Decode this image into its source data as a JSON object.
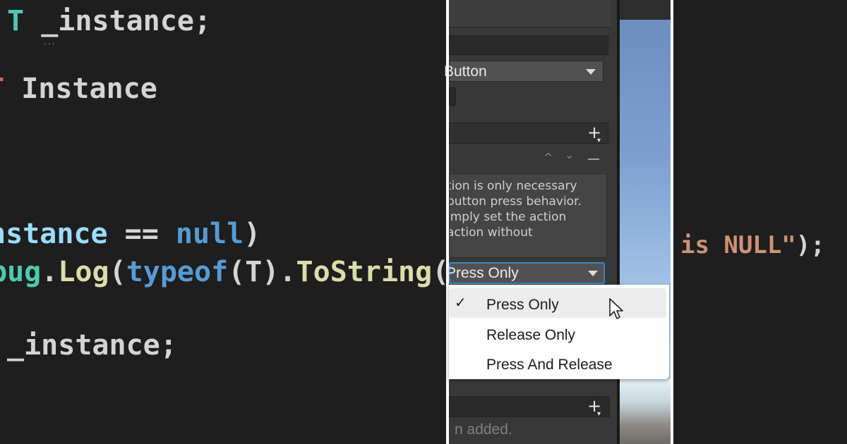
{
  "left_code": {
    "line1": {
      "type": "T",
      "name": "_instance",
      "end": ";"
    },
    "line2": {
      "type": "T",
      "name": "Instance"
    },
    "line3": {
      "var": "nstance",
      "op": " == ",
      "kw": "null",
      "end": ")"
    },
    "line4": {
      "cls": "bug",
      "dot": ".",
      "fn": "Log",
      "open": "(",
      "kw": "typeof",
      "arg": "(T)",
      "dot2": ".",
      "fn2": "ToString",
      "end": "()"
    },
    "line5": {
      "name": "_instance",
      "end": ";"
    }
  },
  "inspector": {
    "button_dropdown": "Button",
    "help_text": [
      "tion is only necessary",
      "button press behavior.",
      "imply set the action",
      "action without"
    ],
    "press_dropdown": "Press Only",
    "menu_items": [
      {
        "label": "Press Only",
        "checked": true
      },
      {
        "label": "Release Only",
        "checked": false
      },
      {
        "label": "Press And Release",
        "checked": false
      }
    ],
    "added_text": "n added.",
    "plus_icon": "+",
    "up_icon": "^",
    "down_icon": "⌄",
    "minus_icon": "—",
    "check_icon": "✓"
  },
  "right_code": {
    "kw": "is",
    "str": " NULL\"",
    "end": ");"
  }
}
